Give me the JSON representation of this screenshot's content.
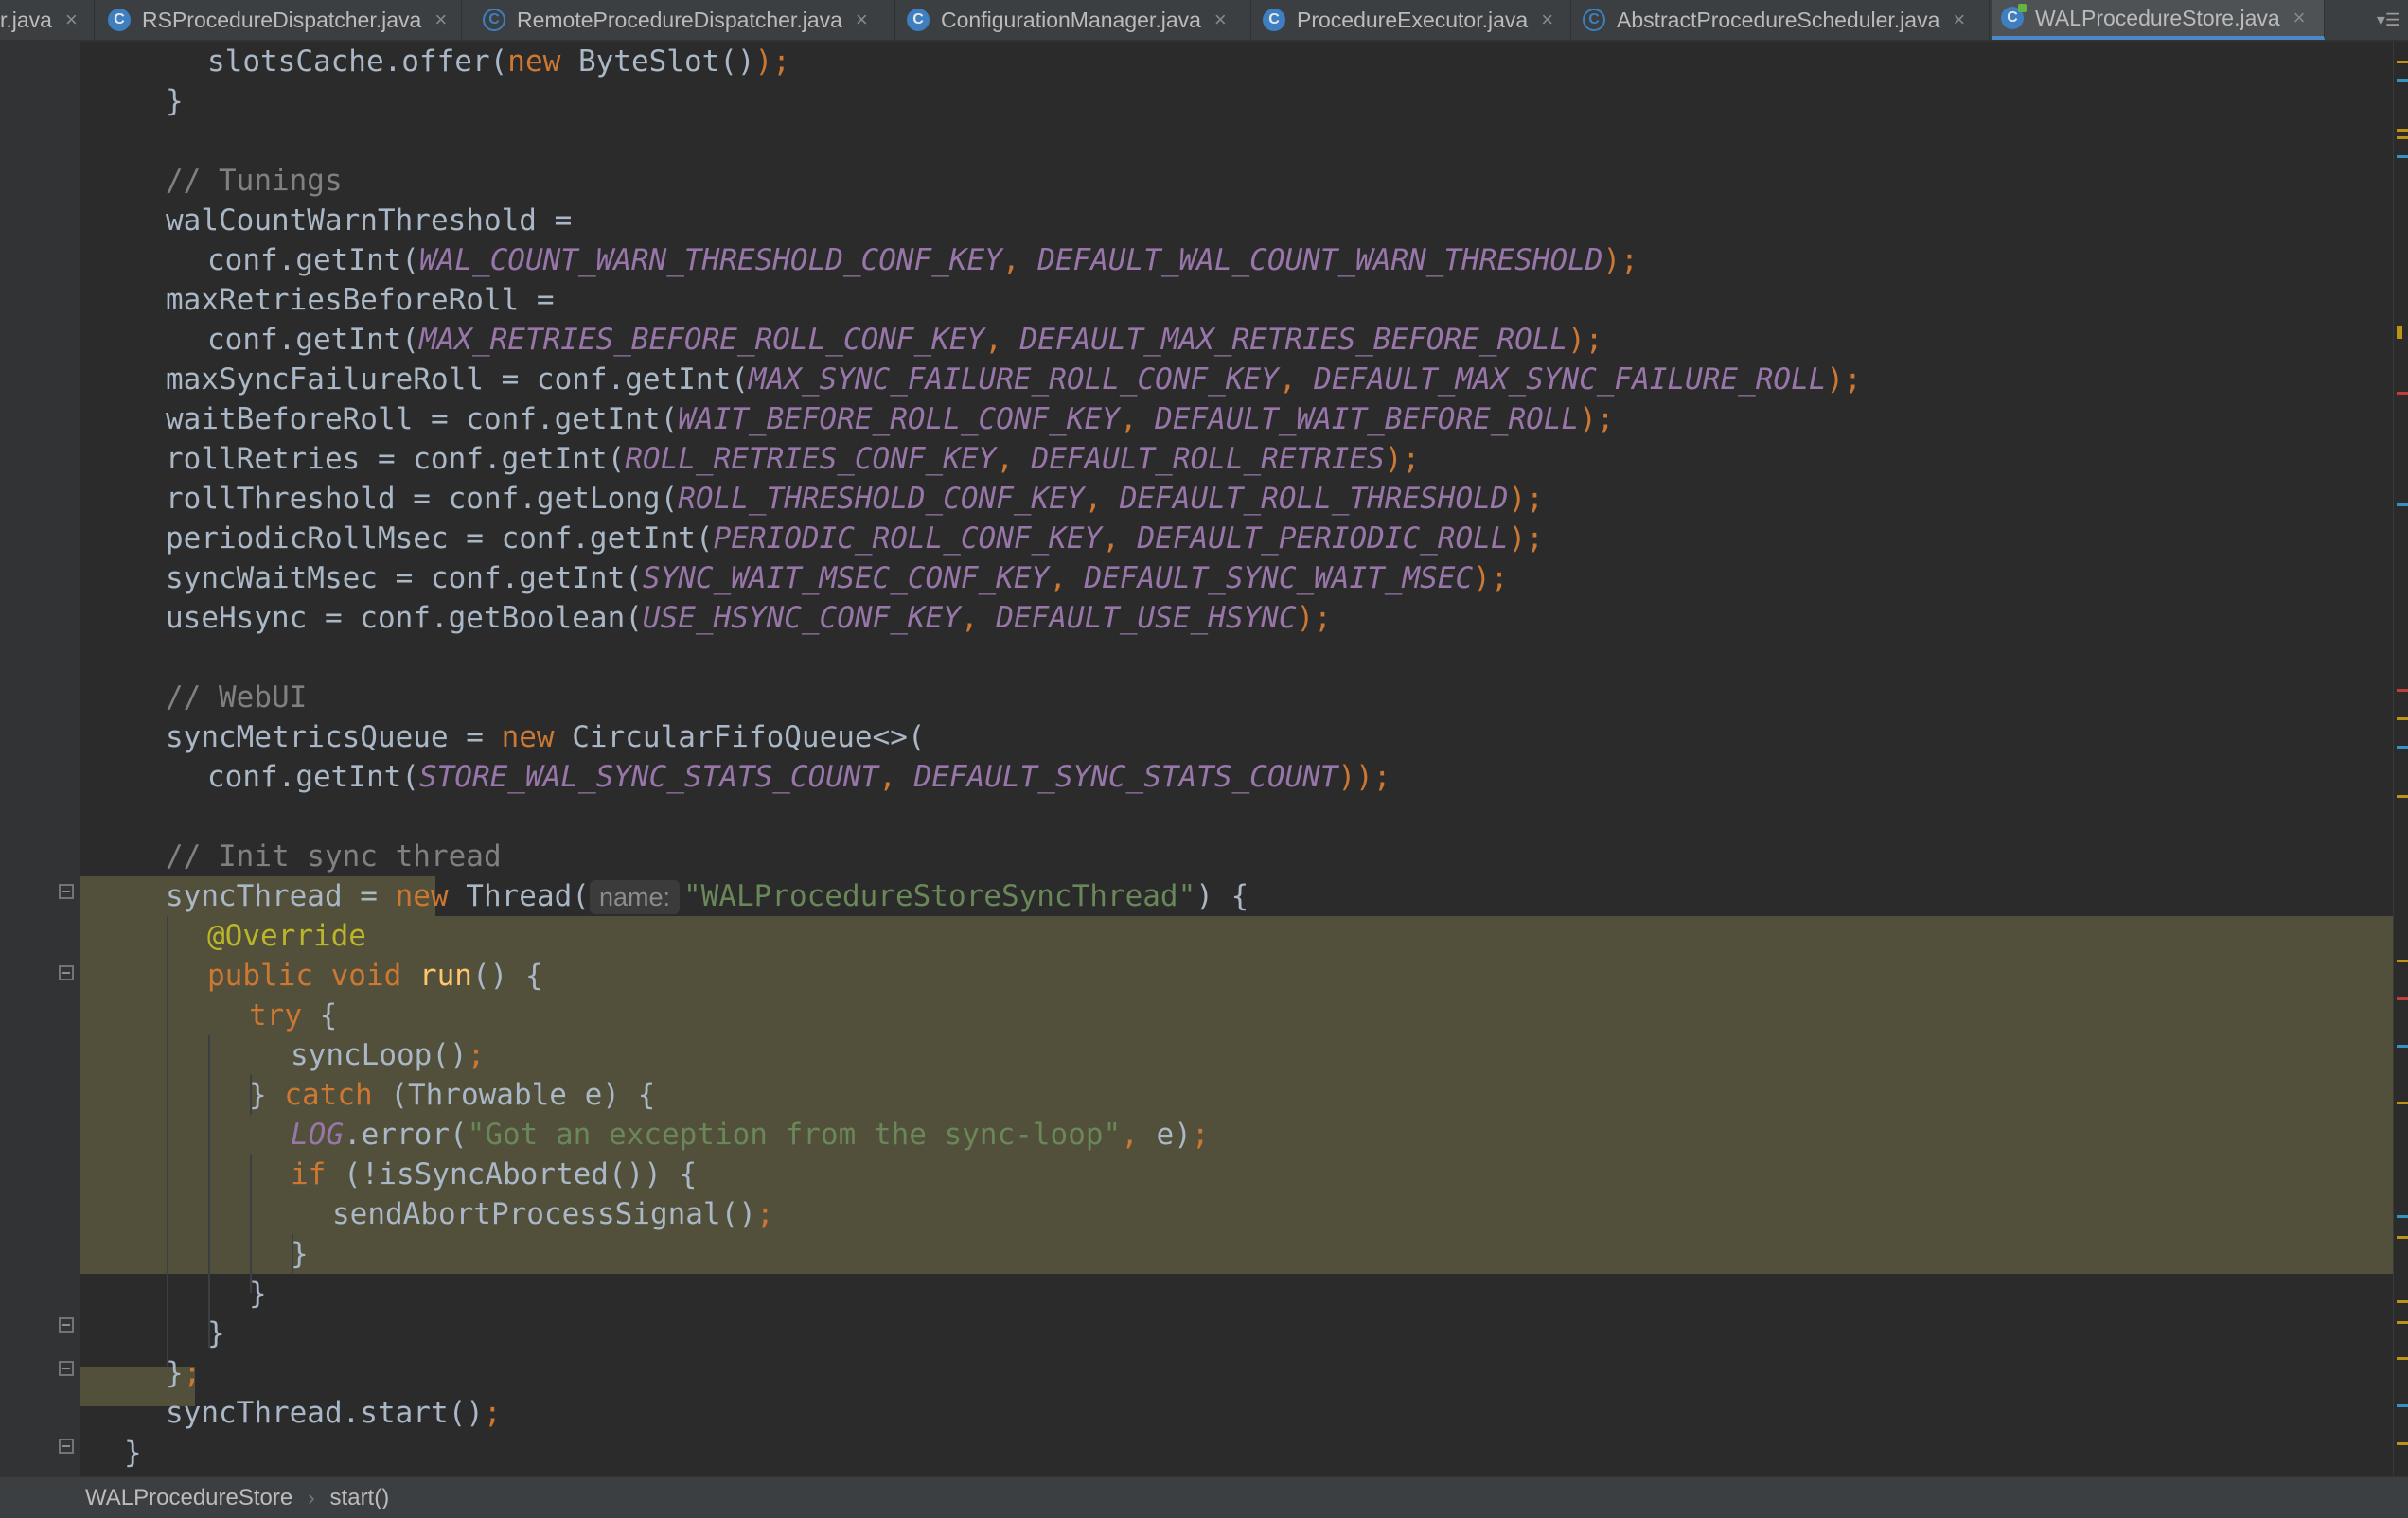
{
  "tabs": [
    {
      "label": "r.java",
      "icon": "none",
      "active": false
    },
    {
      "label": "RSProcedureDispatcher.java",
      "icon": "class",
      "active": false
    },
    {
      "label": "RemoteProcedureDispatcher.java",
      "icon": "abstract-class",
      "active": false
    },
    {
      "label": "ConfigurationManager.java",
      "icon": "class",
      "active": false
    },
    {
      "label": "ProcedureExecutor.java",
      "icon": "class",
      "active": false
    },
    {
      "label": "AbstractProcedureScheduler.java",
      "icon": "abstract-class",
      "active": false
    },
    {
      "label": "WALProcedureStore.java",
      "icon": "class-modified",
      "active": true
    }
  ],
  "tab_close_glyph": "×",
  "tab_overflow_glyph": "▾☰",
  "icon_letter": "C",
  "code": [
    {
      "c": "slotsCache",
      "d": ".offer(",
      "k": "new",
      "r": " ByteSlot()",
      "s": ");"
    },
    {
      "t": "}"
    },
    {
      "t": ""
    },
    {
      "m": "// Tunings"
    },
    {
      "t": "walCountWarnThreshold ="
    },
    {
      "a": "conf.getInt(",
      "x": "WAL_COUNT_WARN_THRESHOLD_CONF_KEY",
      "y": ", ",
      "z": "DEFAULT_WAL_COUNT_WARN_THRESHOLD",
      "e": ");"
    },
    {
      "t": "maxRetriesBeforeRoll ="
    },
    {
      "a": "conf.getInt(",
      "x": "MAX_RETRIES_BEFORE_ROLL_CONF_KEY",
      "y": ", ",
      "z": "DEFAULT_MAX_RETRIES_BEFORE_ROLL",
      "e": ");"
    },
    {
      "a": "maxSyncFailureRoll = conf.getInt(",
      "x": "MAX_SYNC_FAILURE_ROLL_CONF_KEY",
      "y": ", ",
      "z": "DEFAULT_MAX_SYNC_FAILURE_ROLL",
      "e": ");"
    },
    {
      "a": "waitBeforeRoll = conf.getInt(",
      "x": "WAIT_BEFORE_ROLL_CONF_KEY",
      "y": ", ",
      "z": "DEFAULT_WAIT_BEFORE_ROLL",
      "e": ");"
    },
    {
      "a": "rollRetries = conf.getInt(",
      "x": "ROLL_RETRIES_CONF_KEY",
      "y": ", ",
      "z": "DEFAULT_ROLL_RETRIES",
      "e": ");"
    },
    {
      "a": "rollThreshold = conf.getLong(",
      "x": "ROLL_THRESHOLD_CONF_KEY",
      "y": ", ",
      "z": "DEFAULT_ROLL_THRESHOLD",
      "e": ");"
    },
    {
      "a": "periodicRollMsec = conf.getInt(",
      "x": "PERIODIC_ROLL_CONF_KEY",
      "y": ", ",
      "z": "DEFAULT_PERIODIC_ROLL",
      "e": ");"
    },
    {
      "a": "syncWaitMsec = conf.getInt(",
      "x": "SYNC_WAIT_MSEC_CONF_KEY",
      "y": ", ",
      "z": "DEFAULT_SYNC_WAIT_MSEC",
      "e": ");"
    },
    {
      "a": "useHsync = conf.getBoolean(",
      "x": "USE_HSYNC_CONF_KEY",
      "y": ", ",
      "z": "DEFAULT_USE_HSYNC",
      "e": ");"
    },
    {
      "t": ""
    },
    {
      "m": "// WebUI"
    },
    {
      "c": "syncMetricsQueue = ",
      "k": "new",
      "r": " CircularFifoQueue<>("
    },
    {
      "a": "conf.getInt(",
      "x": "STORE_WAL_SYNC_STATS_COUNT",
      "y": ", ",
      "z": "DEFAULT_SYNC_STATS_COUNT",
      "e": "));"
    },
    {
      "t": ""
    },
    {
      "m": "// Init sync thread"
    },
    {
      "c": "syncThread = ",
      "k": "new",
      "r": " Thread(",
      "h": "name:",
      "q": "\"WALProcedureStoreSyncThread\"",
      "w": ") {"
    },
    {
      "n": "@Override"
    },
    {
      "k": "public void",
      "f": " run",
      "r": "() {"
    },
    {
      "k": "try",
      "r": " {"
    },
    {
      "c": "syncLoop()",
      "s": ";"
    },
    {
      "c": "} ",
      "k": "catch",
      "r": " (Throwable e) {"
    },
    {
      "x": "LOG",
      "c": ".error(",
      "q": "\"Got an exception from the sync-loop\"",
      "s": ",",
      "r": " e)",
      "e": ";"
    },
    {
      "k": "if",
      "r": " (!isSyncAborted()) {"
    },
    {
      "c": "sendAbortProcessSignal()",
      "s": ";"
    },
    {
      "t": "}"
    },
    {
      "t": "}"
    },
    {
      "t": "}"
    },
    {
      "c": "}",
      "s": ";"
    },
    {
      "c": "syncThread.start()",
      "s": ";"
    },
    {
      "t": "}"
    }
  ],
  "breadcrumb": {
    "class_name": "WALProcedureStore",
    "separator": "›",
    "method_name": "start()"
  },
  "colors": {
    "keyword": "#cc7832",
    "comment": "#808080",
    "constant": "#9876aa",
    "string": "#6a8759",
    "annotation": "#bbb529",
    "method": "#ffc66d",
    "default": "#a9b7c6",
    "highlight": "#52503a",
    "accent": "#4a88c7"
  }
}
